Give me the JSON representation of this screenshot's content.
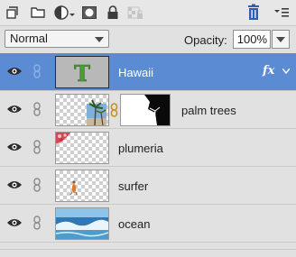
{
  "toolbar": {
    "icons": [
      "new-layer-icon",
      "new-group-icon",
      "adjustment-layer-icon",
      "layer-mask-icon",
      "lock-all-icon",
      "lock-transparency-icon",
      "trash-icon",
      "panel-menu-icon"
    ]
  },
  "blend_mode": {
    "value": "Normal"
  },
  "opacity": {
    "label": "Opacity:",
    "value": "100%"
  },
  "layers": [
    {
      "name": "Hawaii",
      "type": "text",
      "selected": true,
      "thumb_glyph": "T",
      "fx": "fx"
    },
    {
      "name": "palm trees",
      "type": "masked-image",
      "selected": false
    },
    {
      "name": "plumeria",
      "type": "image",
      "selected": false
    },
    {
      "name": "surfer",
      "type": "image",
      "selected": false
    },
    {
      "name": "ocean",
      "type": "image",
      "selected": false
    }
  ],
  "colors": {
    "selected_row": "#5a8bd3",
    "panel_bg": "#e1e1e1",
    "text_thumb": "#b8b8b8",
    "text_glyph": "#4f9a3a",
    "trash_blue": "#2f5fb0"
  }
}
